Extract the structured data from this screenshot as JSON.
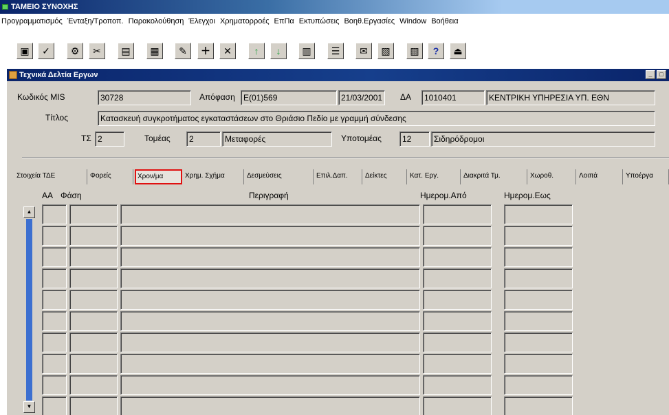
{
  "app": {
    "title": "ΤΑΜΕΙΟ ΣΥΝΟΧΗΣ"
  },
  "menu": [
    "Προγραμματισμός",
    "Ένταξη/Τροποπ.",
    "Παρακολούθηση",
    "Έλεγχοι",
    "Χρηματορροές",
    "ΕπΠα",
    "Εκτυπώσεις",
    "Βοηθ.Εργασίες",
    "Window",
    "Βοήθεια"
  ],
  "toolbar": {
    "icons": [
      "save-icon",
      "check-icon",
      "print-setup-icon",
      "cut-icon",
      "copy-icon",
      "form-icon",
      "edit-icon",
      "insert-icon",
      "delete-icon",
      "arrow-up-icon",
      "arrow-down-icon",
      "printer-icon",
      "list-icon",
      "query-icon",
      "document-icon",
      "clipboard-icon",
      "help-icon",
      "exit-icon"
    ],
    "glyphs": [
      "▣",
      "✓",
      "⚙",
      "✂",
      "▤",
      "▦",
      "✎",
      "＋",
      "✕",
      "↑",
      "↓",
      "▥",
      "☰",
      "✉",
      "▧",
      "▨",
      "?",
      "⏏"
    ],
    "colors": {
      "arrow": "#1f9f3a",
      "help": "#1a2fa8"
    }
  },
  "window": {
    "title": "Τεχνικά Δελτία Εργων",
    "minimize": "_",
    "maximize": "□"
  },
  "form": {
    "mis_label": "Κωδικός MIS",
    "mis_value": "30728",
    "decision_label": "Απόφαση",
    "decision_value": "Ε(01)569",
    "date_value": "21/03/2001",
    "aa_label": "ΔΑ",
    "aa_value": "1010401",
    "agency_value": "ΚΕΝΤΡΙΚΗ ΥΠΗΡΕΣΙΑ ΥΠ. ΕΘΝ",
    "title_label": "Τίτλος",
    "title_value": "Κατασκευή συγκροτήματος εγκαταστάσεων στο Θριάσιο Πεδίο με γραμμή σύνδεσης",
    "ts_label": "ΤΣ",
    "ts_value": "2",
    "sector_label": "Τομέας",
    "sector_code": "2",
    "sector_name": "Μεταφορές",
    "subsector_label": "Υποτομέας",
    "subsector_code": "12",
    "subsector_name": "Σιδηρόδρομοι"
  },
  "tabs": [
    {
      "label": "Στοιχεία ΤΔΕ",
      "active": false
    },
    {
      "label": "Φορείς",
      "active": false
    },
    {
      "label": "Χρον/μα",
      "active": true
    },
    {
      "label": "Χρημ. Σχήμα",
      "active": false
    },
    {
      "label": "Δεσμεύσεις",
      "active": false
    },
    {
      "label": "Επιλ.Δαπ.",
      "active": false
    },
    {
      "label": "Δείκτες",
      "active": false
    },
    {
      "label": "Κατ. Εργ.",
      "active": false
    },
    {
      "label": "Διακριτά Τμ.",
      "active": false
    },
    {
      "label": "Χωροθ.",
      "active": false
    },
    {
      "label": "Λοιπά",
      "active": false
    },
    {
      "label": "Υποέργα",
      "active": false
    }
  ],
  "grid": {
    "headers": {
      "aa": "ΑΑ",
      "phase": "Φάση",
      "description": "Περιγραφή",
      "date_from": "Ημερομ.Από",
      "date_to": "Ημερομ.Εως"
    },
    "row_count": 10,
    "scroll_up": "▲",
    "scroll_down": "▼"
  }
}
